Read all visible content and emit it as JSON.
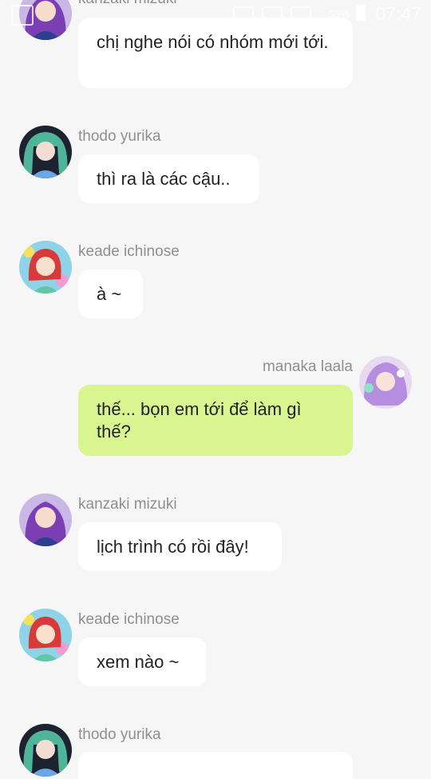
{
  "status_bar": {
    "battery_percent": "55%",
    "time": "07:47"
  },
  "messages": [
    {
      "sender": "kanzaki mizuki",
      "text": "chị nghe nói có nhóm mới tới.",
      "avatar": "purple-hair-avatar"
    },
    {
      "sender": "thodo yurika",
      "text": "thì ra là các cậu..",
      "avatar": "green-twintail-avatar"
    },
    {
      "sender": "keade ichinose",
      "text": "à ~",
      "avatar": "red-hair-avatar"
    },
    {
      "sender": "manaka laala",
      "text": "thế... bọn em tới để làm gì thế?",
      "avatar": "lavender-hair-avatar",
      "self": true
    },
    {
      "sender": "kanzaki mizuki",
      "text": "lịch trình có rồi đây!",
      "avatar": "purple-hair-avatar"
    },
    {
      "sender": "keade ichinose",
      "text": "xem nào ~",
      "avatar": "red-hair-avatar"
    },
    {
      "sender": "thodo yurika",
      "text": "",
      "avatar": "green-twintail-avatar"
    }
  ],
  "colors": {
    "background": "#f6f6f6",
    "incoming_bubble": "#ffffff",
    "outgoing_bubble": "#d9f590",
    "name_text": "#8f8f8f"
  }
}
